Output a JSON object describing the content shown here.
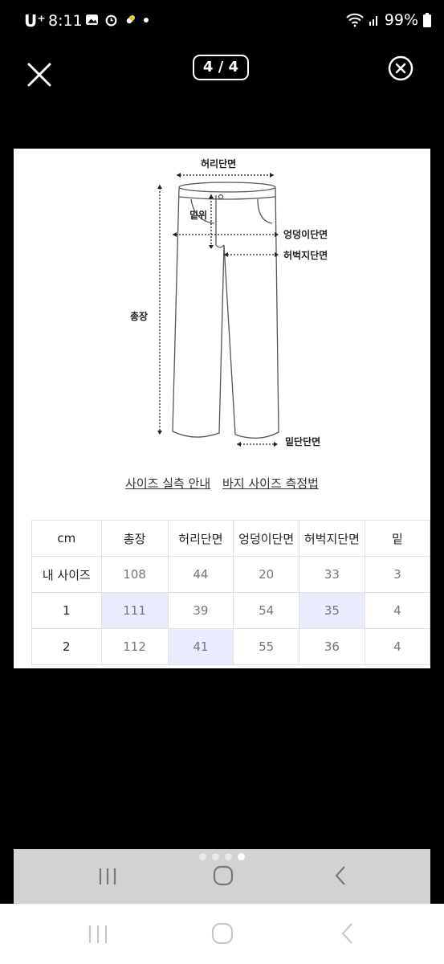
{
  "status_bar": {
    "carrier": "U⁺",
    "time": "8:11",
    "battery": "99%"
  },
  "viewer": {
    "page_indicator": "4 / 4"
  },
  "diagram": {
    "labels": {
      "waist": "허리단면",
      "rise": "밑위",
      "hip": "엉덩이단면",
      "thigh": "허벅지단면",
      "length": "총장",
      "hem": "밑단단면"
    }
  },
  "links": {
    "guide": "사이즈 실측 안내",
    "measure": "바지 사이즈 측정법"
  },
  "table": {
    "headers": [
      "cm",
      "총장",
      "허리단면",
      "엉덩이단면",
      "허벅지단면",
      "밑"
    ],
    "rows": [
      {
        "label": "내 사이즈",
        "cells": [
          "108",
          "44",
          "20",
          "33",
          "3"
        ]
      },
      {
        "label": "1",
        "cells": [
          "111",
          "39",
          "54",
          "35",
          "4"
        ]
      },
      {
        "label": "2",
        "cells": [
          "112",
          "41",
          "55",
          "36",
          "4"
        ]
      }
    ]
  },
  "carousel": {
    "dots": 4,
    "active": 4
  }
}
